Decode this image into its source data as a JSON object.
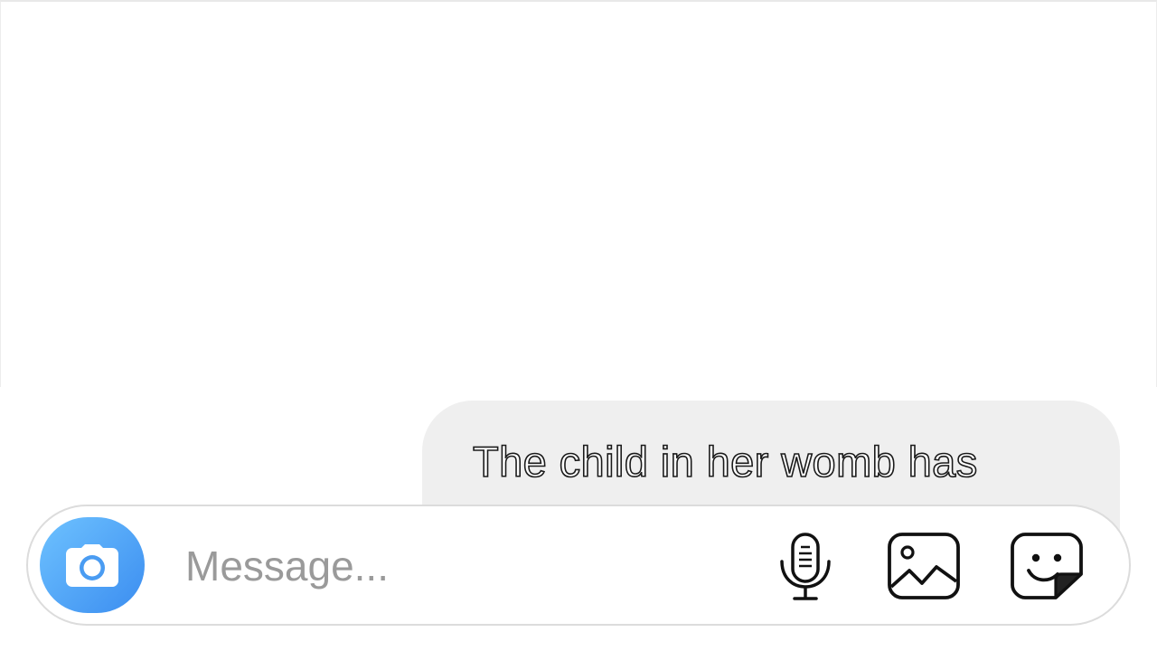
{
  "message": {
    "text_line1": "The child in her womb has",
    "text_line2": ""
  },
  "composer": {
    "placeholder": "Message..."
  },
  "icons": {
    "camera": "camera-icon",
    "microphone": "microphone-icon",
    "gallery": "gallery-icon",
    "sticker": "sticker-icon"
  },
  "colors": {
    "camera_button_start": "#6ec2ff",
    "camera_button_end": "#3b8df0",
    "bubble_background": "#efefef",
    "placeholder": "#9a9a9a"
  }
}
